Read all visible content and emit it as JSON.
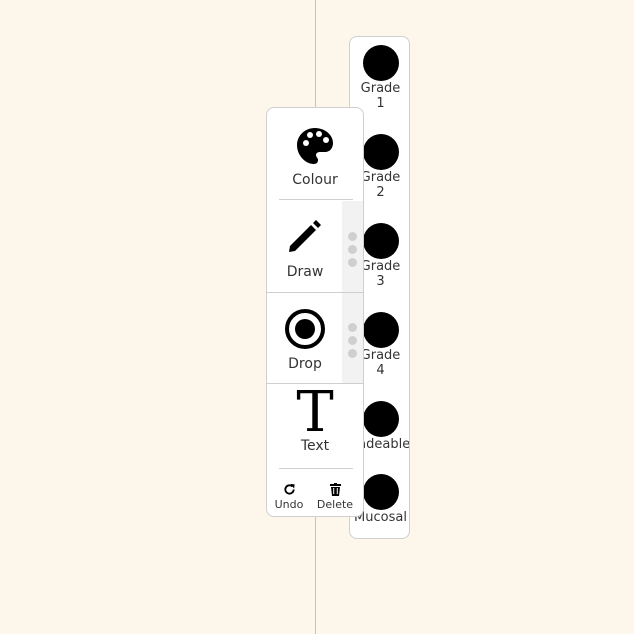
{
  "tools": {
    "colour": {
      "label": "Colour",
      "icon": "palette-icon"
    },
    "draw": {
      "label": "Draw",
      "icon": "pencil-icon"
    },
    "drop": {
      "label": "Drop",
      "icon": "target-icon"
    },
    "text": {
      "label": "Text",
      "glyph": "T",
      "icon": "text-icon"
    },
    "undo": {
      "label": "Undo",
      "icon": "undo-icon"
    },
    "delete": {
      "label": "Delete",
      "icon": "trash-icon"
    }
  },
  "grades": [
    {
      "line1": "Grade",
      "line2": "1",
      "color": "#000000"
    },
    {
      "line1": "Grade",
      "line2": "2",
      "color": "#000000"
    },
    {
      "line1": "Grade",
      "line2": "3",
      "color": "#000000"
    },
    {
      "line1": "Grade",
      "line2": "4",
      "color": "#000000"
    },
    {
      "line1": "Ungradeable",
      "line2": "",
      "color": "#000000"
    },
    {
      "line1": "Mucosal",
      "line2": "",
      "color": "#000000"
    }
  ],
  "colors": {
    "background": "#fdf6ea",
    "dot": "#000000"
  }
}
